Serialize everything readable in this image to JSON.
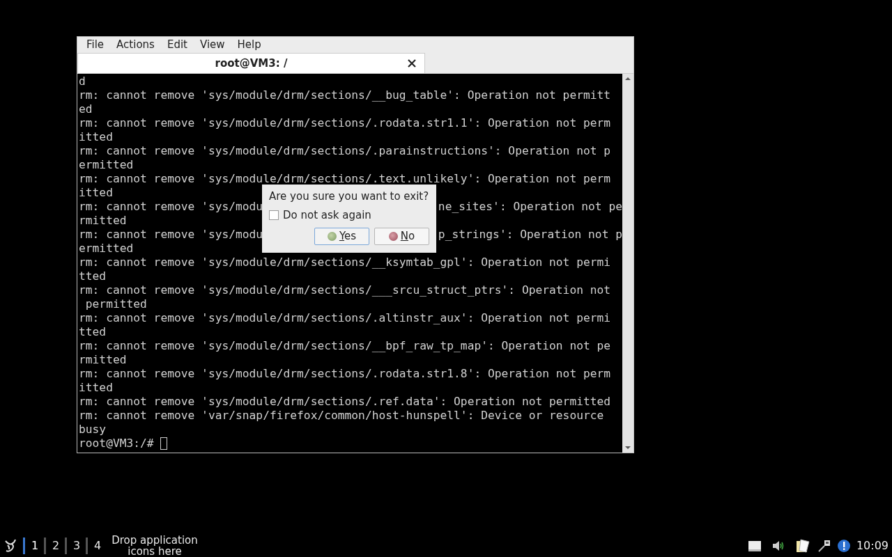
{
  "window": {
    "menu": [
      "File",
      "Actions",
      "Edit",
      "View",
      "Help"
    ],
    "tabs": [
      {
        "label": "root@VM3: /",
        "selected": true
      }
    ],
    "terminal": {
      "lines": [
        {
          "kind": "text",
          "text": "d"
        },
        {
          "kind": "text",
          "text": "rm: cannot remove 'sys/module/drm/sections/__bug_table': Operation not permitt"
        },
        {
          "kind": "text",
          "text": "ed"
        },
        {
          "kind": "text",
          "text": "rm: cannot remove 'sys/module/drm/sections/.rodata.str1.1': Operation not perm"
        },
        {
          "kind": "text",
          "text": "itted"
        },
        {
          "kind": "text",
          "text": "rm: cannot remove 'sys/module/drm/sections/.parainstructions': Operation not p"
        },
        {
          "kind": "text",
          "text": "ermitted"
        },
        {
          "kind": "text",
          "text": "rm: cannot remove 'sys/module/drm/sections/.text.unlikely': Operation not perm"
        },
        {
          "kind": "text",
          "text": "itted"
        },
        {
          "kind": "split",
          "left": "rm: cannot remove 'sys/modu",
          "right": "ne_sites': Operation not pe"
        },
        {
          "kind": "text",
          "text": "rmitted"
        },
        {
          "kind": "split",
          "left": "rm: cannot remove 'sys/modu",
          "right": "p_strings': Operation not p"
        },
        {
          "kind": "text",
          "text": "ermitted"
        },
        {
          "kind": "text",
          "text": "rm: cannot remove 'sys/module/drm/sections/__ksymtab_gpl': Operation not permi"
        },
        {
          "kind": "text",
          "text": "tted"
        },
        {
          "kind": "text",
          "text": "rm: cannot remove 'sys/module/drm/sections/___srcu_struct_ptrs': Operation not"
        },
        {
          "kind": "text",
          "text": " permitted"
        },
        {
          "kind": "text",
          "text": "rm: cannot remove 'sys/module/drm/sections/.altinstr_aux': Operation not permi"
        },
        {
          "kind": "text",
          "text": "tted"
        },
        {
          "kind": "text",
          "text": "rm: cannot remove 'sys/module/drm/sections/__bpf_raw_tp_map': Operation not pe"
        },
        {
          "kind": "text",
          "text": "rmitted"
        },
        {
          "kind": "text",
          "text": "rm: cannot remove 'sys/module/drm/sections/.rodata.str1.8': Operation not perm"
        },
        {
          "kind": "text",
          "text": "itted"
        },
        {
          "kind": "text",
          "text": "rm: cannot remove 'sys/module/drm/sections/.ref.data': Operation not permitted"
        },
        {
          "kind": "text",
          "text": "rm: cannot remove 'var/snap/firefox/common/host-hunspell': Device or resource"
        },
        {
          "kind": "text",
          "text": "busy"
        },
        {
          "kind": "prompt",
          "text": "root@VM3:/# "
        }
      ]
    }
  },
  "dialog": {
    "message": "Are you sure you want to exit?",
    "checkbox": {
      "label": "Do not ask again",
      "checked": false
    },
    "buttons": [
      {
        "label": "Yes",
        "kind": "yes",
        "focused": true
      },
      {
        "label": "No",
        "kind": "no",
        "focused": false
      }
    ]
  },
  "taskbar": {
    "workspaces": [
      {
        "label": "1",
        "selected": true
      },
      {
        "label": "2",
        "selected": false
      },
      {
        "label": "3",
        "selected": false
      },
      {
        "label": "4",
        "selected": false
      }
    ],
    "launcher_hint": "Drop application icons here",
    "clock": "10:09"
  }
}
